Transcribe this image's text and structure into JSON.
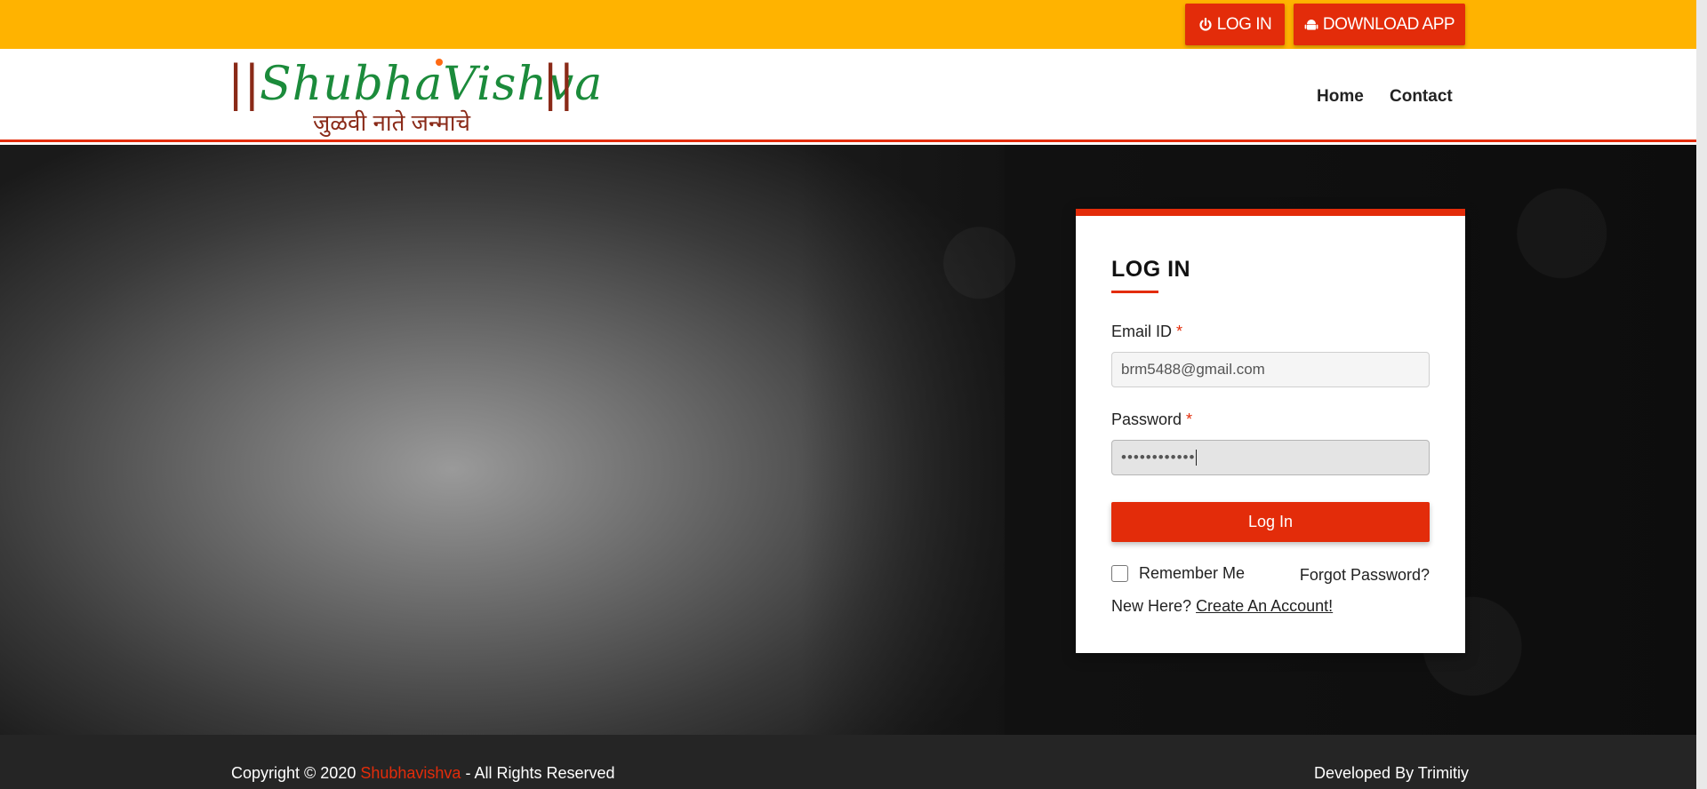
{
  "topbar": {
    "login_label": "LOG IN",
    "download_label": "DOWNLOAD APP",
    "login_icon": "power-icon",
    "download_icon": "android-icon"
  },
  "header": {
    "logo_text": "ShubhaVishva",
    "logo_tagline": "जुळवी नाते जन्माचे",
    "nav": [
      "Home",
      "Contact"
    ]
  },
  "login_card": {
    "title": "LOG IN",
    "email_label": "Email ID",
    "email_value": "brm5488@gmail.com",
    "password_label": "Password",
    "password_value": "••••••••••••",
    "required_mark": "*",
    "submit_label": "Log In",
    "remember_label": "Remember Me",
    "forgot_label": "Forgot Password?",
    "new_here_text": "New Here?",
    "create_account_label": "Create An Account!"
  },
  "footer": {
    "copyright_prefix": "Copyright © 2020",
    "brand": "Shubhavishva",
    "copyright_suffix": "- All Rights Reserved",
    "developed_by": "Developed By Trimitiy"
  },
  "colors": {
    "topbar": "#ffb300",
    "accent": "#e32c0a",
    "logo_green": "#1b8b3b",
    "logo_maroon": "#8a2a18",
    "footer_bg": "#252525"
  }
}
